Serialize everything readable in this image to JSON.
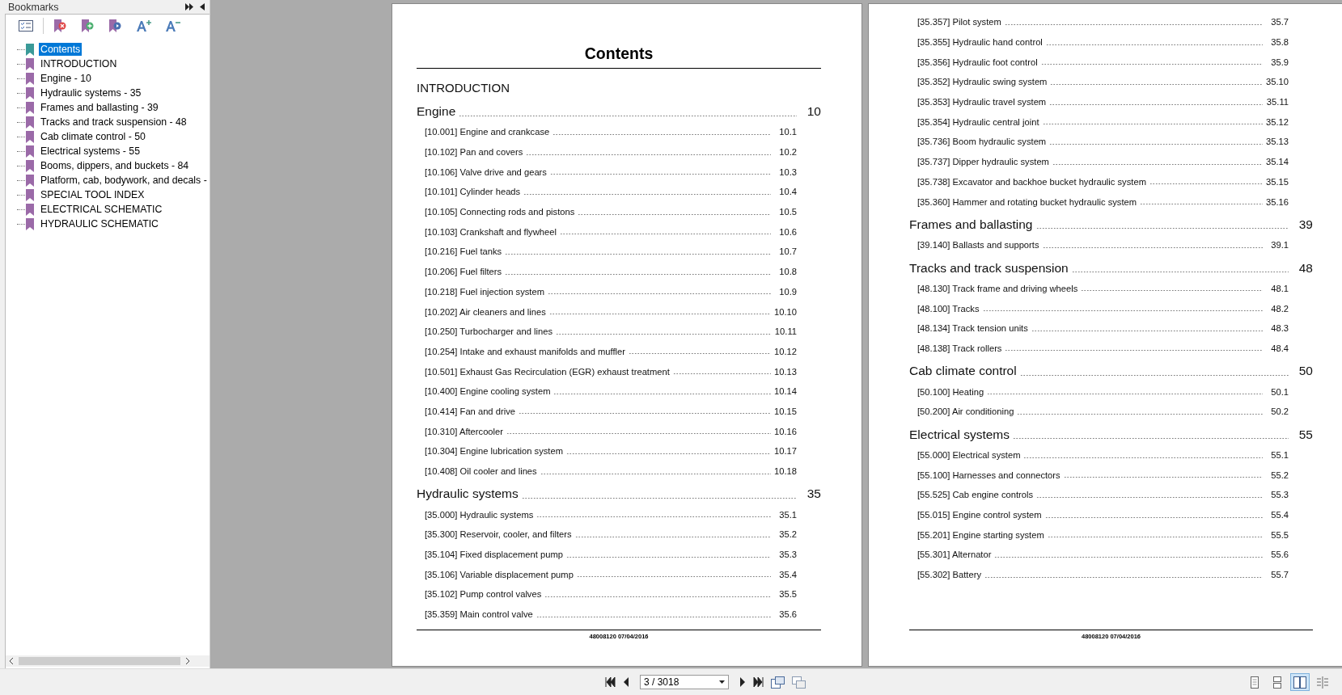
{
  "bookmarks": {
    "title": "Bookmarks",
    "items": [
      {
        "label": "Contents",
        "selected": true
      },
      {
        "label": "INTRODUCTION",
        "selected": false
      },
      {
        "label": "Engine - 10",
        "selected": false
      },
      {
        "label": "Hydraulic systems - 35",
        "selected": false
      },
      {
        "label": "Frames and ballasting - 39",
        "selected": false
      },
      {
        "label": "Tracks and track suspension - 48",
        "selected": false
      },
      {
        "label": "Cab climate control - 50",
        "selected": false
      },
      {
        "label": "Electrical systems - 55",
        "selected": false
      },
      {
        "label": "Booms, dippers, and buckets - 84",
        "selected": false
      },
      {
        "label": "Platform, cab, bodywork, and decals -",
        "selected": false
      },
      {
        "label": "SPECIAL TOOL INDEX",
        "selected": false
      },
      {
        "label": "ELECTRICAL SCHEMATIC",
        "selected": false
      },
      {
        "label": "HYDRAULIC SCHEMATIC",
        "selected": false
      }
    ]
  },
  "pages": [
    {
      "title": "Contents",
      "footer": "48008120 07/04/2016",
      "entries": [
        {
          "kind": "heading",
          "text": "INTRODUCTION"
        },
        {
          "kind": "section",
          "text": "Engine",
          "page": "10"
        },
        {
          "kind": "item",
          "text": "[10.001] Engine and crankcase",
          "page": "10.1"
        },
        {
          "kind": "item",
          "text": "[10.102] Pan and covers",
          "page": "10.2"
        },
        {
          "kind": "item",
          "text": "[10.106] Valve drive and gears",
          "page": "10.3"
        },
        {
          "kind": "item",
          "text": "[10.101] Cylinder heads",
          "page": "10.4"
        },
        {
          "kind": "item",
          "text": "[10.105] Connecting rods and pistons",
          "page": "10.5"
        },
        {
          "kind": "item",
          "text": "[10.103] Crankshaft and flywheel",
          "page": "10.6"
        },
        {
          "kind": "item",
          "text": "[10.216] Fuel tanks",
          "page": "10.7"
        },
        {
          "kind": "item",
          "text": "[10.206] Fuel filters",
          "page": "10.8"
        },
        {
          "kind": "item",
          "text": "[10.218] Fuel injection system",
          "page": "10.9"
        },
        {
          "kind": "item",
          "text": "[10.202] Air cleaners and lines",
          "page": "10.10"
        },
        {
          "kind": "item",
          "text": "[10.250] Turbocharger and lines",
          "page": "10.11"
        },
        {
          "kind": "item",
          "text": "[10.254] Intake and exhaust manifolds and muffler",
          "page": "10.12"
        },
        {
          "kind": "item",
          "text": "[10.501] Exhaust Gas Recirculation (EGR) exhaust treatment",
          "page": "10.13"
        },
        {
          "kind": "item",
          "text": "[10.400] Engine cooling system",
          "page": "10.14"
        },
        {
          "kind": "item",
          "text": "[10.414] Fan and drive",
          "page": "10.15"
        },
        {
          "kind": "item",
          "text": "[10.310] Aftercooler",
          "page": "10.16"
        },
        {
          "kind": "item",
          "text": "[10.304] Engine lubrication system",
          "page": "10.17"
        },
        {
          "kind": "item",
          "text": "[10.408] Oil cooler and lines",
          "page": "10.18"
        },
        {
          "kind": "section",
          "text": "Hydraulic systems",
          "page": "35"
        },
        {
          "kind": "item",
          "text": "[35.000] Hydraulic systems",
          "page": "35.1"
        },
        {
          "kind": "item",
          "text": "[35.300] Reservoir, cooler, and filters",
          "page": "35.2"
        },
        {
          "kind": "item",
          "text": "[35.104] Fixed displacement pump",
          "page": "35.3"
        },
        {
          "kind": "item",
          "text": "[35.106] Variable displacement pump",
          "page": "35.4"
        },
        {
          "kind": "item",
          "text": "[35.102] Pump control valves",
          "page": "35.5"
        },
        {
          "kind": "item",
          "text": "[35.359] Main control valve",
          "page": "35.6"
        }
      ]
    },
    {
      "footer": "48008120 07/04/2016",
      "entries": [
        {
          "kind": "item",
          "text": "[35.357] Pilot system",
          "page": "35.7"
        },
        {
          "kind": "item",
          "text": "[35.355] Hydraulic hand control",
          "page": "35.8"
        },
        {
          "kind": "item",
          "text": "[35.356] Hydraulic foot control",
          "page": "35.9"
        },
        {
          "kind": "item",
          "text": "[35.352] Hydraulic swing system",
          "page": "35.10"
        },
        {
          "kind": "item",
          "text": "[35.353] Hydraulic travel system",
          "page": "35.11"
        },
        {
          "kind": "item",
          "text": "[35.354] Hydraulic central joint",
          "page": "35.12"
        },
        {
          "kind": "item",
          "text": "[35.736] Boom hydraulic system",
          "page": "35.13"
        },
        {
          "kind": "item",
          "text": "[35.737] Dipper hydraulic system",
          "page": "35.14"
        },
        {
          "kind": "item",
          "text": "[35.738] Excavator and backhoe bucket hydraulic system",
          "page": "35.15"
        },
        {
          "kind": "item",
          "text": "[35.360] Hammer and rotating bucket hydraulic system",
          "page": "35.16"
        },
        {
          "kind": "section",
          "text": "Frames and ballasting",
          "page": "39"
        },
        {
          "kind": "item",
          "text": "[39.140] Ballasts and supports",
          "page": "39.1"
        },
        {
          "kind": "section",
          "text": "Tracks and track suspension",
          "page": "48"
        },
        {
          "kind": "item",
          "text": "[48.130] Track frame and driving wheels",
          "page": "48.1"
        },
        {
          "kind": "item",
          "text": "[48.100] Tracks",
          "page": "48.2"
        },
        {
          "kind": "item",
          "text": "[48.134] Track tension units",
          "page": "48.3"
        },
        {
          "kind": "item",
          "text": "[48.138] Track rollers",
          "page": "48.4"
        },
        {
          "kind": "section",
          "text": "Cab climate control",
          "page": "50"
        },
        {
          "kind": "item",
          "text": "[50.100] Heating",
          "page": "50.1"
        },
        {
          "kind": "item",
          "text": "[50.200] Air conditioning",
          "page": "50.2"
        },
        {
          "kind": "section",
          "text": "Electrical systems",
          "page": "55"
        },
        {
          "kind": "item",
          "text": "[55.000] Electrical system",
          "page": "55.1"
        },
        {
          "kind": "item",
          "text": "[55.100] Harnesses and connectors",
          "page": "55.2"
        },
        {
          "kind": "item",
          "text": "[55.525] Cab engine controls",
          "page": "55.3"
        },
        {
          "kind": "item",
          "text": "[55.015] Engine control system",
          "page": "55.4"
        },
        {
          "kind": "item",
          "text": "[55.201] Engine starting system",
          "page": "55.5"
        },
        {
          "kind": "item",
          "text": "[55.301] Alternator",
          "page": "55.6"
        },
        {
          "kind": "item",
          "text": "[55.302] Battery",
          "page": "55.7"
        }
      ]
    }
  ],
  "navigation": {
    "page_field": "3 / 3018",
    "view_modes": [
      {
        "selected": false
      },
      {
        "selected": false
      },
      {
        "selected": true
      },
      {
        "selected": false
      }
    ]
  }
}
